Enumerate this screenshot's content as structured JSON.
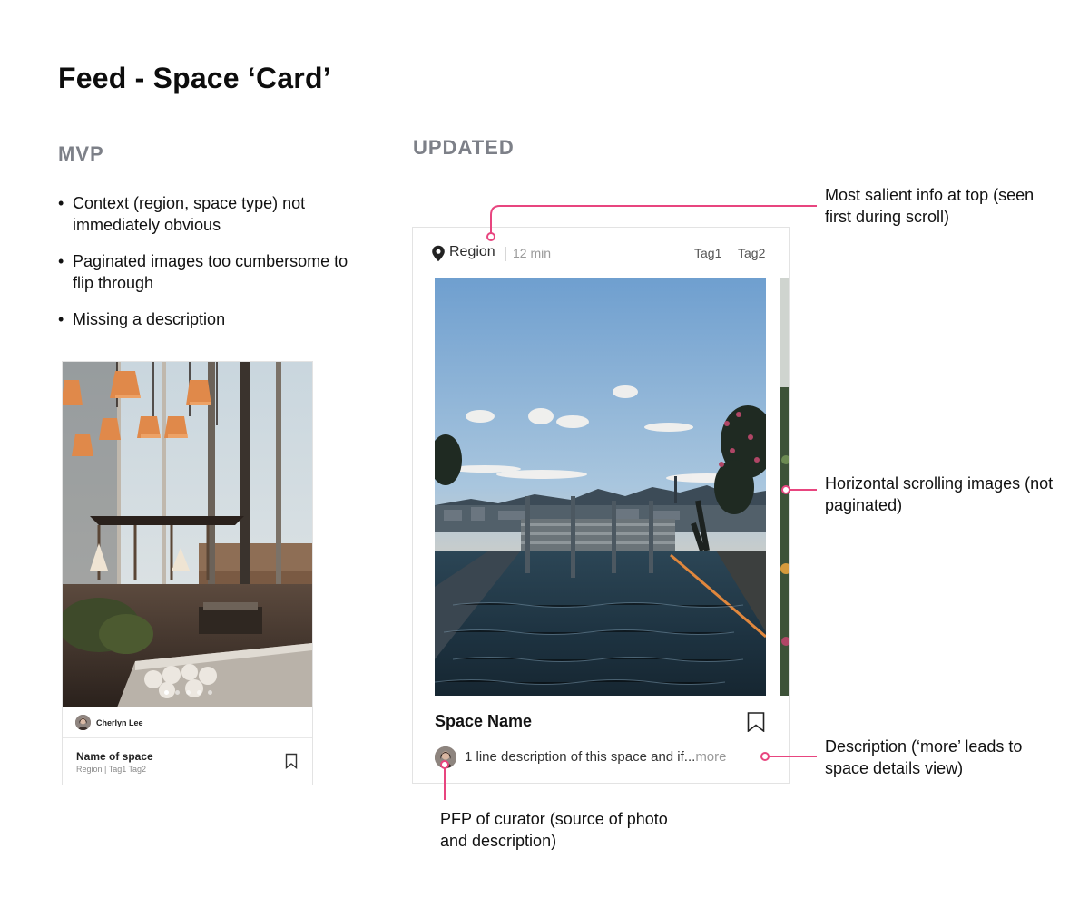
{
  "page": {
    "title": "Feed - Space ‘Card’"
  },
  "mvp": {
    "label": "MVP",
    "bullets": [
      "Context (region, space type) not immediately obvious",
      "Paginated images too cumbersome to flip through",
      "Missing a description"
    ],
    "card": {
      "curator_name": "Cherlyn Lee",
      "space_name": "Name of space",
      "meta": "Region | Tag1 Tag2",
      "page_count": 5,
      "active_page": 1
    }
  },
  "updated": {
    "label": "UPDATED",
    "card": {
      "region": "Region",
      "time": "12 min",
      "tags": [
        "Tag1",
        "Tag2"
      ],
      "space_name": "Space Name",
      "description": "1 line description of this space and if...",
      "more_label": "more"
    }
  },
  "annotations": {
    "top_info": "Most salient info at top (seen first during scroll)",
    "scroll": "Horizontal scrolling images (not paginated)",
    "description": "Description (‘more’ leads to space details view)",
    "pfp": "PFP of curator (source of photo and description)"
  },
  "colors": {
    "accent": "#e8457f",
    "section_label": "#7d8088",
    "border": "#e3e3e3"
  },
  "icons": {
    "location": "map-pin-icon",
    "bookmark": "bookmark-icon"
  }
}
